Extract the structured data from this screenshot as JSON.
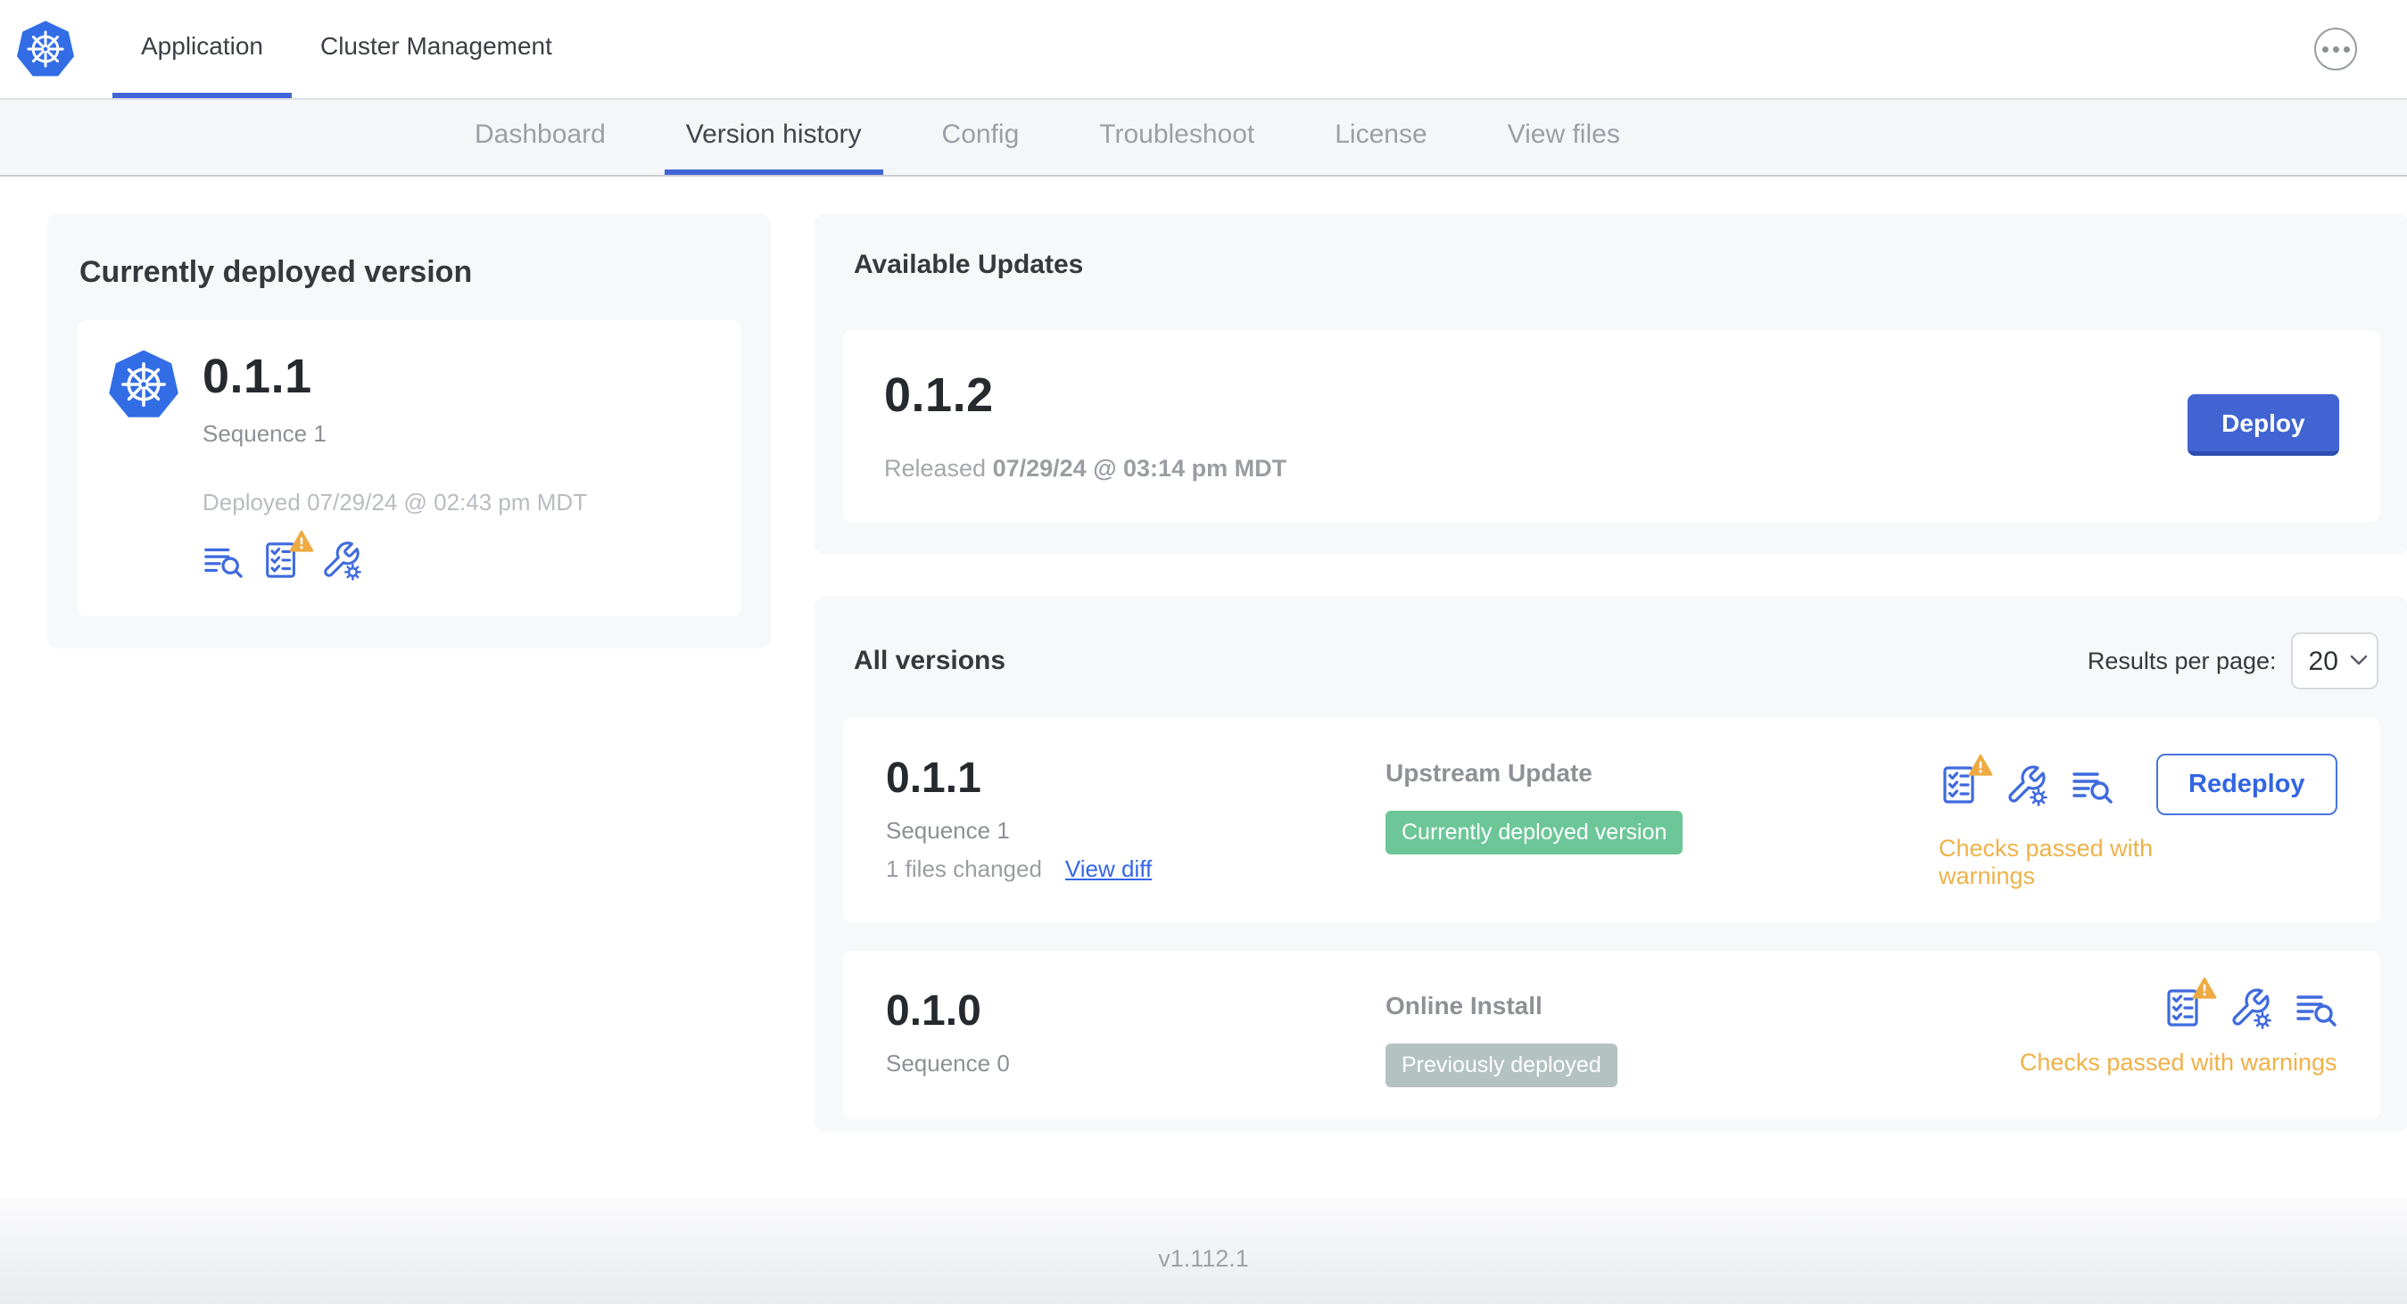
{
  "top_nav": {
    "tabs": [
      {
        "label": "Application",
        "active": true
      },
      {
        "label": "Cluster Management",
        "active": false
      }
    ]
  },
  "sub_nav": {
    "tabs": [
      {
        "label": "Dashboard",
        "active": false
      },
      {
        "label": "Version history",
        "active": true
      },
      {
        "label": "Config",
        "active": false
      },
      {
        "label": "Troubleshoot",
        "active": false
      },
      {
        "label": "License",
        "active": false
      },
      {
        "label": "View files",
        "active": false
      }
    ]
  },
  "current_version": {
    "title": "Currently deployed version",
    "version": "0.1.1",
    "sequence": "Sequence 1",
    "deployed": "Deployed 07/29/24 @ 02:43 pm MDT",
    "icons": [
      "view-logs-icon",
      "preflight-checks-warning-icon",
      "config-icon"
    ]
  },
  "available_updates": {
    "title": "Available Updates",
    "version": "0.1.2",
    "released_prefix": "Released ",
    "released_date": "07/29/24 @ 03:14 pm MDT",
    "deploy_label": "Deploy"
  },
  "all_versions": {
    "title": "All versions",
    "results_per_page_label": "Results per page:",
    "results_per_page_value": "20",
    "rows": [
      {
        "version": "0.1.1",
        "sequence": "Sequence 1",
        "files_changed": "1 files changed",
        "view_diff_label": "View diff",
        "source": "Upstream Update",
        "badge": "Currently deployed version",
        "badge_color": "#6cc697",
        "status": "Checks passed with warnings",
        "action_label": "Redeploy",
        "icons": [
          "preflight-checks-warning-icon",
          "config-icon",
          "view-logs-icon"
        ]
      },
      {
        "version": "0.1.0",
        "sequence": "Sequence 0",
        "source": "Online Install",
        "badge": "Previously deployed",
        "badge_color": "#b5c2c2",
        "status": "Checks passed with warnings",
        "icons": [
          "preflight-checks-warning-icon",
          "config-icon",
          "view-logs-icon"
        ]
      }
    ]
  },
  "footer": {
    "version": "v1.112.1"
  },
  "colors": {
    "accent_blue": "#4165d6",
    "kubernetes_blue": "#326de6",
    "deploy_button": "#4164d2",
    "link_blue": "#3566e8",
    "green_badge": "#6cc697",
    "gray_badge": "#b5c2c2",
    "warning_amber": "#eeb249",
    "card_background": "#f7f8fa",
    "subnav_background": "#f5f6f8"
  }
}
